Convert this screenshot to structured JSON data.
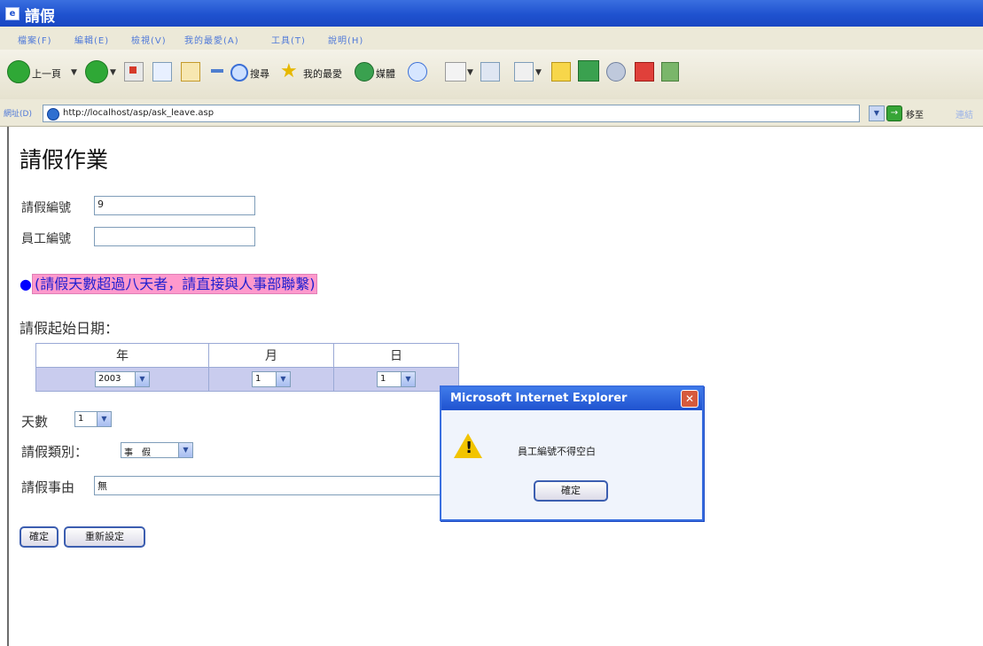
{
  "window": {
    "title": "請假"
  },
  "menu": {
    "items": [
      "檔案(F)",
      "編輯(E)",
      "檢視(V)",
      "我的最愛(A)",
      "工具(T)",
      "說明(H)"
    ]
  },
  "toolbar": {
    "back_label": "上一頁",
    "search_label": "搜尋",
    "favorites_label": "我的最愛",
    "media_label": "媒體"
  },
  "address": {
    "label": "網址(D)",
    "url": "http://localhost/asp/ask_leave.asp",
    "go_label": "移至",
    "links_label": "連結"
  },
  "form": {
    "heading": "請假作業",
    "leave_id_label": "請假編號",
    "leave_id_value": "9",
    "employee_id_label": "員工編號",
    "employee_id_value": "",
    "notice_bullet": "●",
    "notice_text": "(請假天數超過八天者，請直接與人事部聯繫)",
    "start_date_label": "請假起始日期：",
    "date_headers": {
      "year": "年",
      "month": "月",
      "day": "日"
    },
    "date_values": {
      "year": "2003",
      "month": "1",
      "day": "1"
    },
    "days_label": "天數",
    "days_value": "1",
    "type_label": "請假類別：",
    "type_value": "事　假",
    "reason_label": "請假事由",
    "reason_value": "無",
    "submit_label": "確定",
    "reset_label": "重新設定"
  },
  "dialog": {
    "title": "Microsoft Internet Explorer",
    "message": "員工編號不得空白",
    "ok_label": "確定"
  }
}
